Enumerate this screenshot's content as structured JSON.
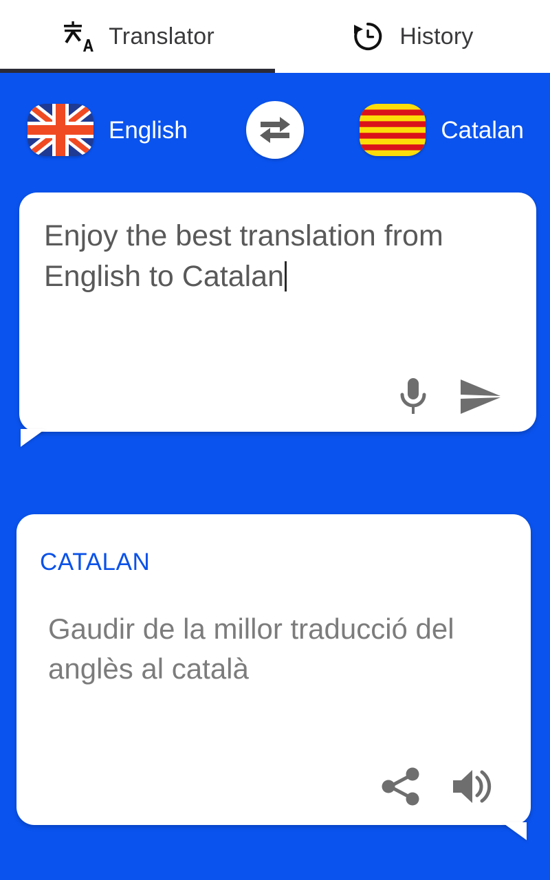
{
  "theme": {
    "background_blue": "#0a53ee",
    "card_white": "#ffffff",
    "tab_text": "#3a3a3c",
    "tab_indicator": "#2b2b38",
    "input_text": "#595959",
    "output_text": "#7c7c7c",
    "label_blue": "#0a52e8",
    "icon_gray": "#6e6e6e"
  },
  "tabs": [
    {
      "id": "translator",
      "label": "Translator",
      "icon": "translate-icon",
      "active": true
    },
    {
      "id": "history",
      "label": "History",
      "icon": "history-icon",
      "active": false
    }
  ],
  "language_bar": {
    "source": {
      "name": "English",
      "flag": "uk-flag-icon"
    },
    "target": {
      "name": "Catalan",
      "flag": "catalan-flag-icon"
    },
    "swap": {
      "label": "",
      "icon": "swap-horizontal-icon"
    }
  },
  "input_card": {
    "text": "Enjoy the best translation from English to Catalan",
    "placeholder": "Enter text",
    "caret_visible": true,
    "actions": [
      {
        "id": "mic",
        "icon": "microphone-icon",
        "label": ""
      },
      {
        "id": "send",
        "icon": "send-icon",
        "label": ""
      }
    ]
  },
  "output_card": {
    "language_label": "CATALAN",
    "text": "Gaudir de la millor traducció del anglès al català",
    "actions": [
      {
        "id": "share",
        "icon": "share-icon",
        "label": ""
      },
      {
        "id": "speak",
        "icon": "volume-up-icon",
        "label": ""
      }
    ]
  }
}
